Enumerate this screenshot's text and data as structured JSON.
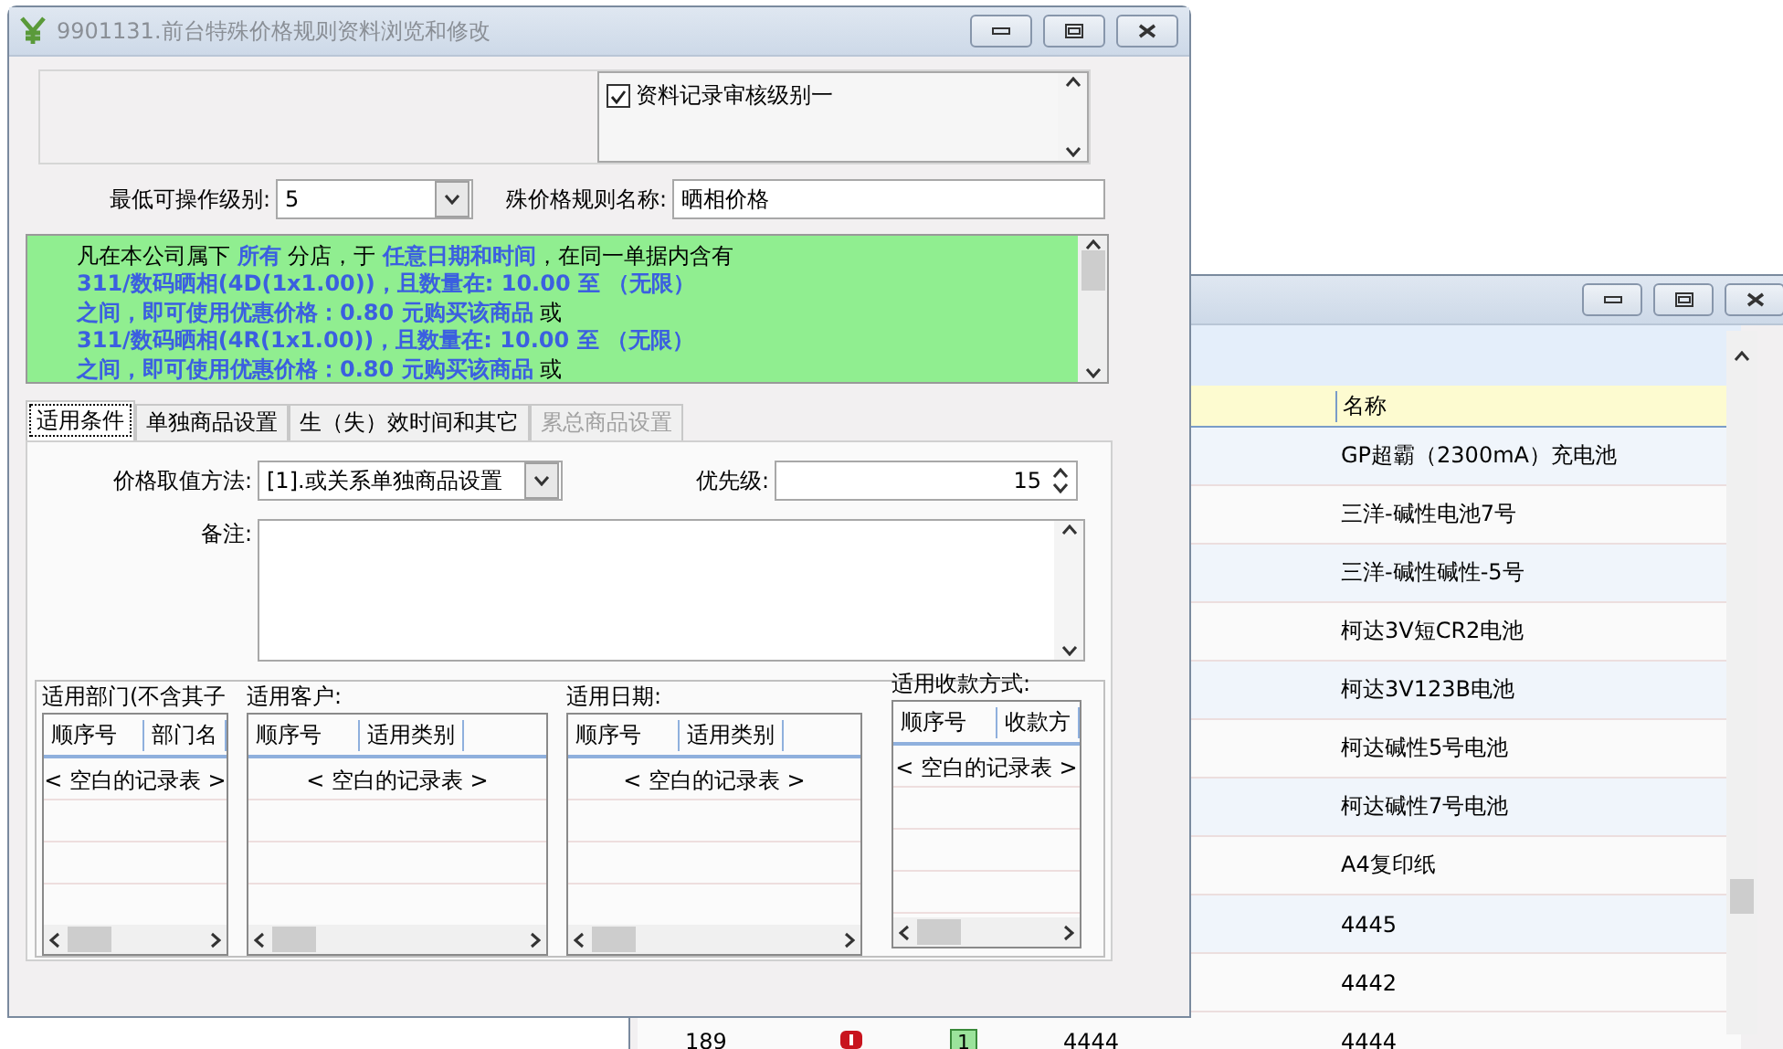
{
  "main_window": {
    "title": "9901131.前台特殊价格规则资料浏览和修改"
  },
  "audit_list": [
    {
      "label": "资料记录审核级别一",
      "checked": true
    }
  ],
  "min_level": {
    "label": "最低可操作级别:",
    "value": "5"
  },
  "rule_name": {
    "label": "殊价格规则名称:",
    "value": "晒相价格"
  },
  "description": [
    "凡在本公司属下 **所有** 分店，于 **任意日期和时间**，在同一单据内含有",
    "**311/数码晒相(4D(1x1.00))，且数量在: 10.00 至 （无限）**",
    "**之间，即可使用优惠价格：0.80 元购买该商品** 或",
    "**311/数码晒相(4R(1x1.00))，且数量在: 10.00 至 （无限）**",
    "**之间，即可使用优惠价格：0.80 元购买该商品** 或"
  ],
  "tabs": [
    {
      "label": "适用条件",
      "selected": true,
      "disabled": false
    },
    {
      "label": "单独商品设置",
      "selected": false,
      "disabled": false
    },
    {
      "label": "生（失）效时间和其它",
      "selected": false,
      "disabled": false
    },
    {
      "label": "累总商品设置",
      "selected": false,
      "disabled": true
    }
  ],
  "price_method": {
    "label": "价格取值方法:",
    "value": "[1].或关系单独商品设置"
  },
  "priority": {
    "label": "优先级:",
    "value": "15"
  },
  "remarks": {
    "label": "备注:"
  },
  "grids": [
    {
      "title": "适用部门(不含其子",
      "columns": [
        "顺序号",
        "部门名"
      ],
      "empty_text": "< 空白的记录表 >"
    },
    {
      "title": "适用客户:",
      "columns": [
        "顺序号",
        "适用类别"
      ],
      "empty_text": "< 空白的记录表 >"
    },
    {
      "title": "适用日期:",
      "columns": [
        "顺序号",
        "适用类别"
      ],
      "empty_text": "< 空白的记录表 >"
    },
    {
      "title": "适用收款方式:",
      "columns": [
        "顺序号",
        "收款方"
      ],
      "empty_text": "< 空白的记录表 >"
    }
  ],
  "background_window": {
    "column": "名称",
    "rows": [
      "GP超霸（2300mA）充电池",
      "三洋-碱性电池7号",
      "三洋-碱性碱性-5号",
      "柯达3V短CR2电池",
      "柯达3V123B电池",
      "柯达碱性5号电池",
      "柯达碱性7号电池",
      "A4复印纸",
      "4445",
      "4442"
    ],
    "partial_row": {
      "number": "189",
      "flag": "1",
      "code": "4444",
      "name": "4444"
    }
  }
}
